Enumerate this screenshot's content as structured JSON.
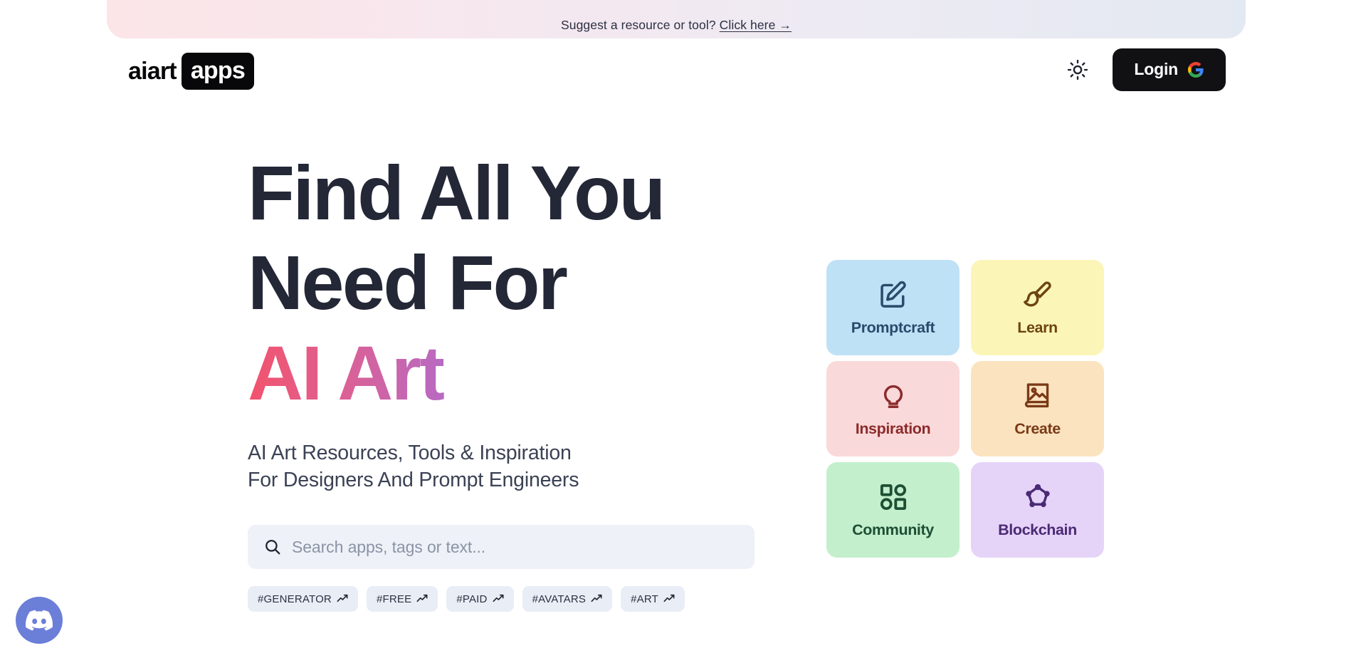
{
  "banner": {
    "text": "Suggest a resource or tool?",
    "link_label": "Click here →"
  },
  "header": {
    "logo_word": "aiart",
    "logo_badge": "apps",
    "theme_toggle_icon": "sun-icon",
    "login_label": "Login",
    "google_icon": "google-g-icon"
  },
  "hero": {
    "headline_line1": "Find All You",
    "headline_line2": "Need For",
    "headline_line3": "AI Art",
    "subhead_line1": "AI Art Resources, Tools & Inspiration",
    "subhead_line2": "For Designers And Prompt Engineers"
  },
  "search": {
    "placeholder": "Search apps, tags or text...",
    "value": "",
    "icon": "search-icon"
  },
  "tags": [
    {
      "label": "#GENERATOR",
      "icon": "trending-up-icon"
    },
    {
      "label": "#FREE",
      "icon": "trending-up-icon"
    },
    {
      "label": "#PAID",
      "icon": "trending-up-icon"
    },
    {
      "label": "#AVATARS",
      "icon": "trending-up-icon"
    },
    {
      "label": "#ART",
      "icon": "trending-up-icon"
    }
  ],
  "tiles": [
    {
      "label": "Promptcraft",
      "icon": "pencil-square-icon",
      "bg": "#bfe1f6",
      "fg": "#2b4a6b"
    },
    {
      "label": "Learn",
      "icon": "paintbrush-icon",
      "bg": "#fbf6b8",
      "fg": "#6d4410"
    },
    {
      "label": "Inspiration",
      "icon": "lightbulb-icon",
      "bg": "#fad9da",
      "fg": "#8c2b2b"
    },
    {
      "label": "Create",
      "icon": "photo-book-icon",
      "bg": "#fbe3c0",
      "fg": "#7a3a17"
    },
    {
      "label": "Community",
      "icon": "shapes-grid-icon",
      "bg": "#c3efcd",
      "fg": "#1d4f33"
    },
    {
      "label": "Blockchain",
      "icon": "blockchain-nodes-icon",
      "bg": "#e5d4f8",
      "fg": "#4b2a75"
    }
  ],
  "floating": {
    "discord_icon": "discord-icon",
    "discord_color": "#6b7ed8"
  },
  "colors": {
    "headline": "#232736",
    "login_bg": "#111114",
    "banner_gradient_start": "#fbe5e7",
    "banner_gradient_end": "#e3e9f2",
    "search_bg": "#eef1f7",
    "tag_bg": "#e9edf5"
  }
}
